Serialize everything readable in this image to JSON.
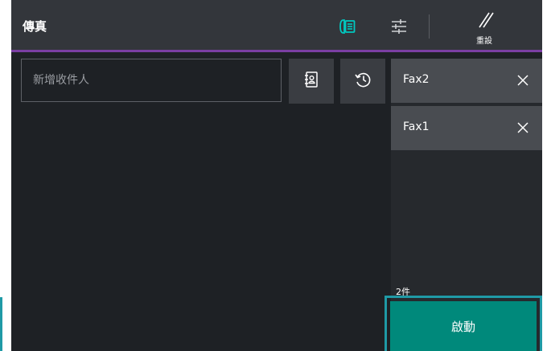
{
  "header": {
    "title": "傳真",
    "reset_label": "重設"
  },
  "recipient": {
    "placeholder": "新增收件人",
    "value": ""
  },
  "recipients": [
    {
      "label": "Fax2"
    },
    {
      "label": "Fax1"
    }
  ],
  "count_label": "2件",
  "start_label": "啟動",
  "colors": {
    "accent": "#7b3fa3",
    "start": "#00897b",
    "focus": "#1f9aa6",
    "active_icon": "#00c8c0"
  },
  "icons": {
    "fax_mode": "fax-icon",
    "settings": "sliders-icon",
    "reset": "reset-icon",
    "address_book": "address-book-icon",
    "history": "history-icon",
    "remove": "close-icon"
  }
}
